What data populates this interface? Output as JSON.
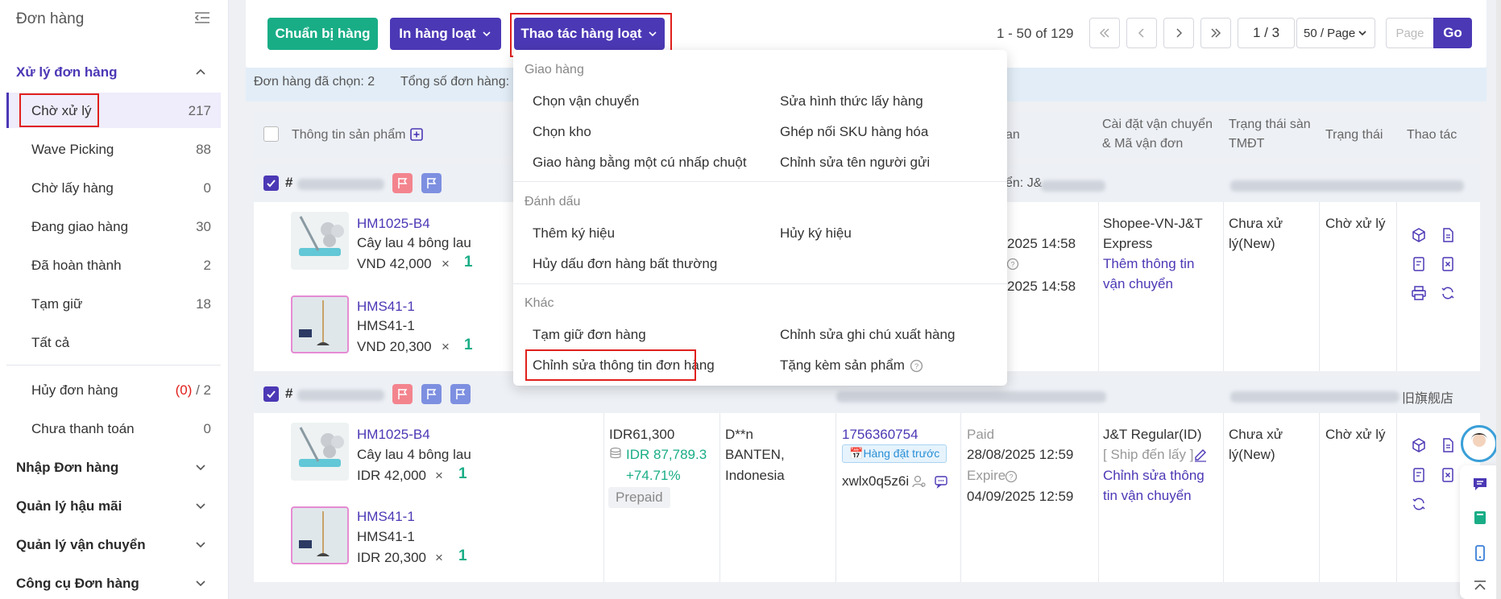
{
  "sidebar": {
    "title": "Đơn hàng",
    "group_active": "Xử lý đơn hàng",
    "items": [
      {
        "label": "Chờ xử lý",
        "count": "217"
      },
      {
        "label": "Wave Picking",
        "count": "88"
      },
      {
        "label": "Chờ lấy hàng",
        "count": "0"
      },
      {
        "label": "Đang giao hàng",
        "count": "30"
      },
      {
        "label": "Đã hoàn thành",
        "count": "2"
      },
      {
        "label": "Tạm giữ",
        "count": "18"
      },
      {
        "label": "Tất cả",
        "count": ""
      }
    ],
    "cancel_label": "Hủy đơn hàng",
    "cancel_red": "(0)",
    "cancel_total": "/ 2",
    "unpaid_label": "Chưa thanh toán",
    "unpaid_count": "0",
    "groups": [
      "Nhập Đơn hàng",
      "Quản lý hậu mãi",
      "Quản lý vận chuyển",
      "Công cụ Đơn hàng"
    ]
  },
  "toolbar": {
    "prepare": "Chuẩn bị hàng",
    "bulk_print": "In hàng loạt",
    "bulk_ops": "Thao tác hàng loạt"
  },
  "pagination": {
    "range": "1 - 50 of 129",
    "page": "1 / 3",
    "page_size": "50 / Page",
    "page_placeholder": "Page",
    "go": "Go"
  },
  "info": {
    "selected": "Đơn hàng đã chọn: 2",
    "total": "Tổng số đơn hàng:"
  },
  "table_headers": {
    "product": "Thông tin sản phẩm",
    "partial_time": "an",
    "shipping_line1": "Cài đặt vận chuyển",
    "shipping_line2": "& Mã vận đơn",
    "platform_line1": "Trạng thái sàn",
    "platform_line2": "TMĐT",
    "status": "Trạng thái",
    "actions": "Thao tác"
  },
  "dropdown": {
    "sections": [
      {
        "title": "Giao hàng",
        "items": [
          "Chọn vận chuyển",
          "Sửa hình thức lấy hàng",
          "Chọn kho",
          "Ghép nối SKU hàng hóa",
          "Giao hàng bằng một cú nhấp chuột",
          "Chỉnh sửa tên người gửi"
        ]
      },
      {
        "title": "Đánh dấu",
        "items": [
          "Thêm ký hiệu",
          "Hủy ký hiệu",
          "Hủy dấu đơn hàng bất thường"
        ]
      },
      {
        "title": "Khác",
        "items": [
          "Tạm giữ đơn hàng",
          "Chỉnh sửa ghi chú xuất hàng",
          "Chỉnh sửa thông tin đơn hàng",
          "Tặng kèm sản phẩm"
        ]
      }
    ]
  },
  "orders": [
    {
      "hash": "#",
      "header_carrier_partial": "ển: J&",
      "products": [
        {
          "sku": "HM1025-B4",
          "name": "Cây lau 4 bông lau",
          "price": "VND 42,000",
          "x": "×",
          "qty": "1"
        },
        {
          "sku": "HMS41-1",
          "name": "HMS41-1",
          "price": "VND 20,300",
          "x": "×",
          "qty": "1"
        }
      ],
      "time1": "2025 14:58",
      "time2": "2025 14:58",
      "shipping": "Shopee-VN-J&T",
      "shipping2": "Express",
      "shipping_link1": "Thêm thông tin",
      "shipping_link2": "vận chuyển",
      "platform": "Chưa xử",
      "platform2": "lý(New)",
      "status": "Chờ xử lý"
    },
    {
      "hash": "#",
      "header_right": "旧旗舰店",
      "products": [
        {
          "sku": "HM1025-B4",
          "name": "Cây lau 4 bông lau",
          "price": "IDR 42,000",
          "x": "×",
          "qty": "1"
        },
        {
          "sku": "HMS41-1",
          "name": "HMS41-1",
          "price": "IDR 20,300",
          "x": "×",
          "qty": "1"
        }
      ],
      "amount": "IDR61,300",
      "amount2": "IDR 87,789.3",
      "profit": "+74.71%",
      "prepaid": "Prepaid",
      "buyer": "D**n",
      "buyer_region": "BANTEN,",
      "buyer_country": "Indonesia",
      "order_no": "1756360754",
      "preorder": "Hàng đặt trước",
      "buyer_id": "xwlx0q5z6i",
      "paid": "Paid",
      "paid_time": "28/08/2025 12:59",
      "expire": "Expire",
      "expire_time": "04/09/2025 12:59",
      "shipping": "J&T Regular(ID)",
      "ship_method": "[ Ship đến lấy ]",
      "shipping_link1": "Chỉnh sửa thông",
      "shipping_link2": "tin vận chuyển",
      "platform": "Chưa xử",
      "platform2": "lý(New)",
      "status": "Chờ xử lý"
    }
  ]
}
